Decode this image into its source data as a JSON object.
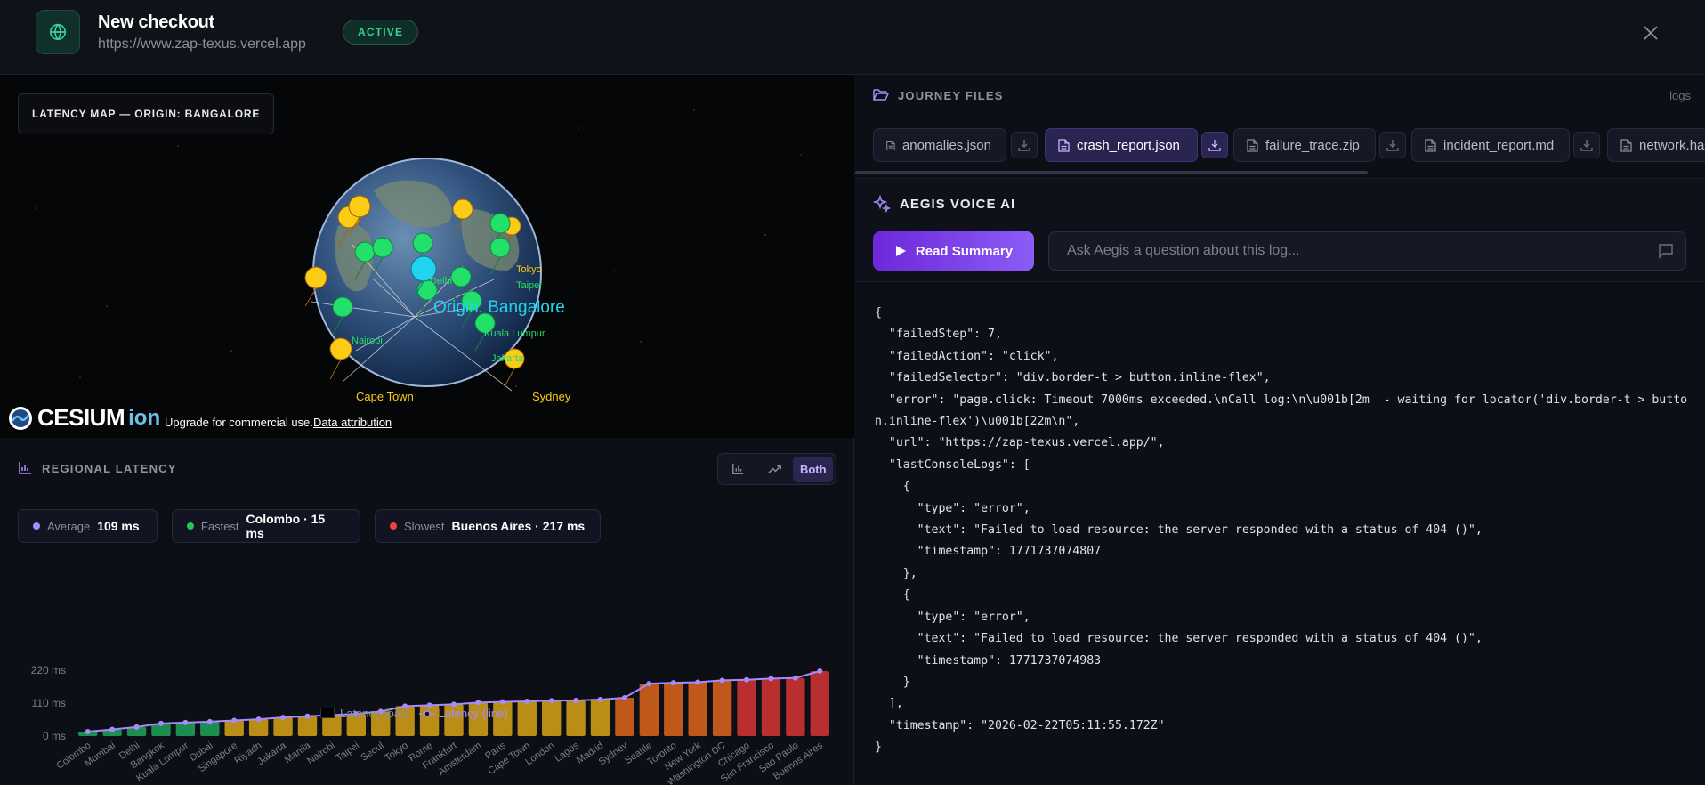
{
  "header": {
    "title": "New checkout",
    "url": "https://www.zap-texus.vercel.app",
    "status": "ACTIVE",
    "globe_icon": "globe-icon",
    "close_icon": "close-icon"
  },
  "map": {
    "label": "LATENCY MAP — ORIGIN: BANGALORE",
    "origin_label": "Origin: Bangalore",
    "city_labels": [
      "Cape Town",
      "Sydney",
      "Tokyo",
      "Taipei",
      "Delhi",
      "Jakarta",
      "Kuala Lumpur",
      "Nairobi"
    ],
    "cesium_brand": "CESIUM",
    "cesium_ion": "ion",
    "upgrade_text": "Upgrade for commercial use.",
    "attribution_link": "Data attribution"
  },
  "regional": {
    "title": "REGIONAL LATENCY",
    "toggle": {
      "bar_icon": "bar-chart-icon",
      "line_icon": "trend-line-icon",
      "both_label": "Both",
      "selected": "Both"
    },
    "stats": [
      {
        "label": "Average",
        "value": "109 ms",
        "color": "#a78bfa"
      },
      {
        "label": "Fastest",
        "value": "Colombo · 15 ms",
        "color": "#22c55e"
      },
      {
        "label": "Slowest",
        "value": "Buenos Aires · 217 ms",
        "color": "#ef4444"
      }
    ]
  },
  "chart_data": {
    "type": "bar",
    "categories": [
      "Colombo",
      "Mumbai",
      "Delhi",
      "Bangkok",
      "Kuala Lumpur",
      "Dubai",
      "Singapore",
      "Riyadh",
      "Jakarta",
      "Manila",
      "Nairobi",
      "Taipei",
      "Seoul",
      "Tokyo",
      "Rome",
      "Frankfurt",
      "Amsterdam",
      "Paris",
      "Cape Town",
      "London",
      "Lagos",
      "Madrid",
      "Sydney",
      "Seattle",
      "Toronto",
      "New York",
      "Washington DC",
      "Chicago",
      "San Francisco",
      "Sao Paulo",
      "Buenos Aires"
    ],
    "series": [
      {
        "name": "Latency (bar)",
        "values": [
          15,
          22,
          30,
          42,
          45,
          48,
          52,
          56,
          62,
          66,
          70,
          74,
          82,
          100,
          103,
          106,
          112,
          114,
          116,
          118,
          119,
          122,
          128,
          175,
          178,
          180,
          186,
          188,
          192,
          194,
          217
        ]
      },
      {
        "name": "Latency (line)",
        "values": [
          15,
          22,
          30,
          42,
          45,
          48,
          52,
          56,
          62,
          66,
          70,
          74,
          82,
          100,
          103,
          106,
          112,
          114,
          116,
          118,
          119,
          122,
          128,
          175,
          178,
          180,
          186,
          188,
          192,
          194,
          217
        ]
      }
    ],
    "yticks": [
      "0 ms",
      "110 ms",
      "220 ms"
    ],
    "ylim": [
      0,
      220
    ],
    "xlabel": "",
    "ylabel": "",
    "legend_placement": "bottom-center",
    "bar_colors": {
      "fast": "#22a55a",
      "mid": "#d9a514",
      "slow": "#e0651c",
      "worst": "#d83434"
    },
    "line_color": "#a78bfa"
  },
  "files": {
    "title": "JOURNEY FILES",
    "logs_label": "logs",
    "items": [
      {
        "name": "anomalies.json",
        "active": false
      },
      {
        "name": "crash_report.json",
        "active": true
      },
      {
        "name": "failure_trace.zip",
        "active": false
      },
      {
        "name": "incident_report.md",
        "active": false
      },
      {
        "name": "network.har",
        "active": false
      }
    ],
    "visible_last_name": "network.ha"
  },
  "aegis": {
    "title": "AEGIS VOICE AI",
    "read_button": "Read Summary",
    "ask_placeholder": "Ask Aegis a question about this log...",
    "sparkle_icon": "sparkle-icon",
    "chat_icon": "chat-bubble-icon"
  },
  "log_text": "{\n  \"failedStep\": 7,\n  \"failedAction\": \"click\",\n  \"failedSelector\": \"div.border-t > button.inline-flex\",\n  \"error\": \"page.click: Timeout 7000ms exceeded.\\nCall log:\\n\\u001b[2m  - waiting for locator('div.border-t > button.inline-flex')\\u001b[22m\\n\",\n  \"url\": \"https://zap-texus.vercel.app/\",\n  \"lastConsoleLogs\": [\n    {\n      \"type\": \"error\",\n      \"text\": \"Failed to load resource: the server responded with a status of 404 ()\",\n      \"timestamp\": 1771737074807\n    },\n    {\n      \"type\": \"error\",\n      \"text\": \"Failed to load resource: the server responded with a status of 404 ()\",\n      \"timestamp\": 1771737074983\n    }\n  ],\n  \"timestamp\": \"2026-02-22T05:11:55.172Z\"\n}"
}
